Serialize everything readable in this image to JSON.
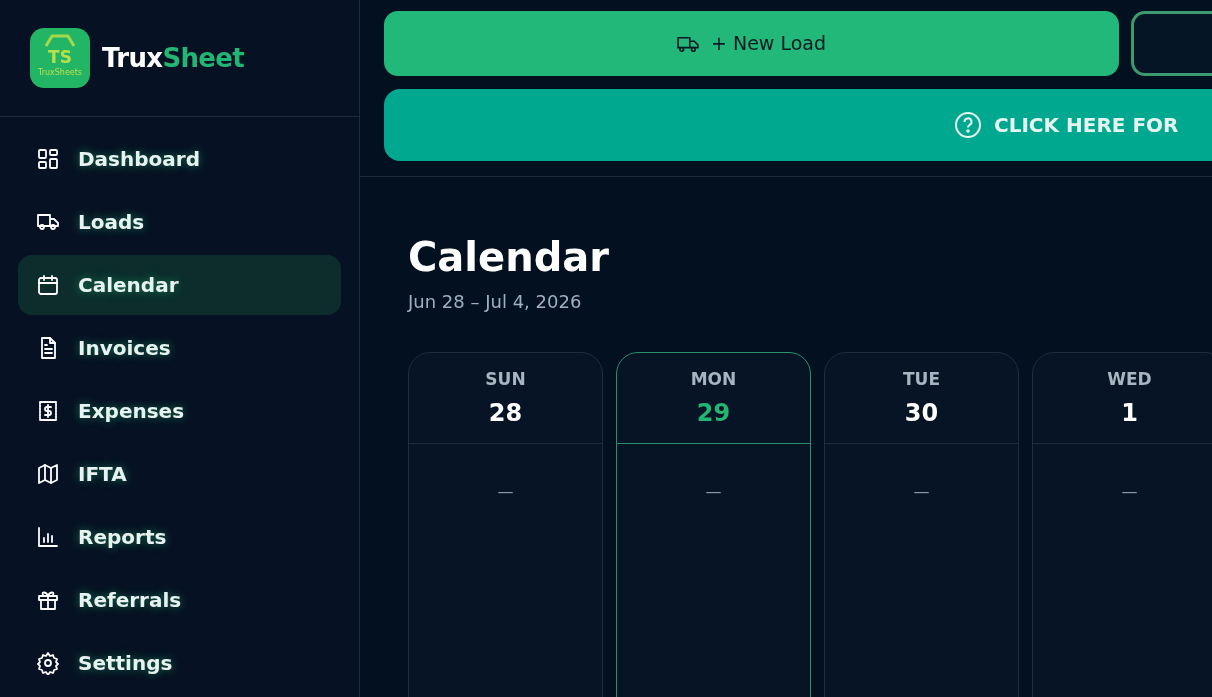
{
  "brand": {
    "logo_mark": "TS",
    "logo_caption": "TruxSheets",
    "name_first": "Trux",
    "name_second": "Sheet"
  },
  "sidebar": {
    "items": [
      {
        "label": "Dashboard",
        "selected": false
      },
      {
        "label": "Loads",
        "selected": false
      },
      {
        "label": "Calendar",
        "selected": true
      },
      {
        "label": "Invoices",
        "selected": false
      },
      {
        "label": "Expenses",
        "selected": false
      },
      {
        "label": "IFTA",
        "selected": false
      },
      {
        "label": "Reports",
        "selected": false
      },
      {
        "label": "Referrals",
        "selected": false
      },
      {
        "label": "Settings",
        "selected": false
      }
    ]
  },
  "toolbar": {
    "new_load_button": "+ New Load",
    "help_banner": "CLICK HERE FOR"
  },
  "page": {
    "title": "Calendar",
    "date_range": "Jun 28 – Jul 4, 2026"
  },
  "days": [
    {
      "weekday": "SUN",
      "date": "28",
      "today": false,
      "empty_mark": "—"
    },
    {
      "weekday": "MON",
      "date": "29",
      "today": true,
      "empty_mark": "—"
    },
    {
      "weekday": "TUE",
      "date": "30",
      "today": false,
      "empty_mark": "—"
    },
    {
      "weekday": "WED",
      "date": "1",
      "today": false,
      "empty_mark": "—"
    }
  ]
}
